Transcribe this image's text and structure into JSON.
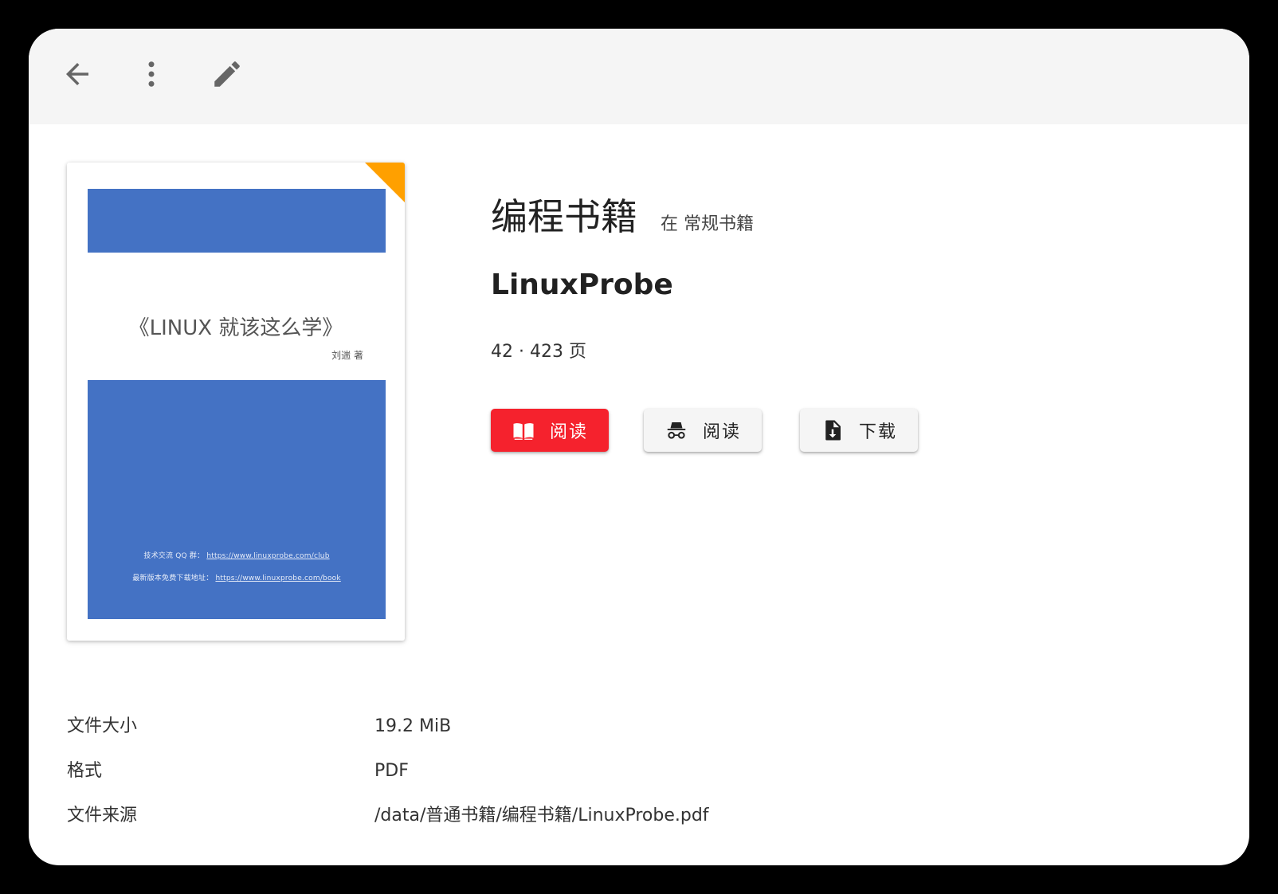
{
  "toolbar": {
    "back_icon": "arrow-left-icon",
    "menu_icon": "more-vertical-icon",
    "edit_icon": "pencil-icon"
  },
  "cover": {
    "title": "《LINUX 就该这么学》",
    "author": "刘遄 著",
    "line1_label": "技术交流 QQ 群：",
    "line1_link": "https://www.linuxprobe.com/club",
    "line2_label": "最新版本免费下载地址：",
    "line2_link": "https://www.linuxprobe.com/book",
    "band_color": "#4472c4",
    "corner_color": "#ffa000"
  },
  "book": {
    "category": "编程书籍",
    "library": "在 常规书籍",
    "title": "LinuxProbe",
    "pages": "42 · 423 页"
  },
  "actions": {
    "read_label": "阅读",
    "incognito_read_label": "阅读",
    "download_label": "下载",
    "primary_color": "#f5222d"
  },
  "meta": [
    {
      "key": "文件大小",
      "value": "19.2 MiB"
    },
    {
      "key": "格式",
      "value": "PDF"
    },
    {
      "key": "文件来源",
      "value": "/data/普通书籍/编程书籍/LinuxProbe.pdf"
    }
  ]
}
